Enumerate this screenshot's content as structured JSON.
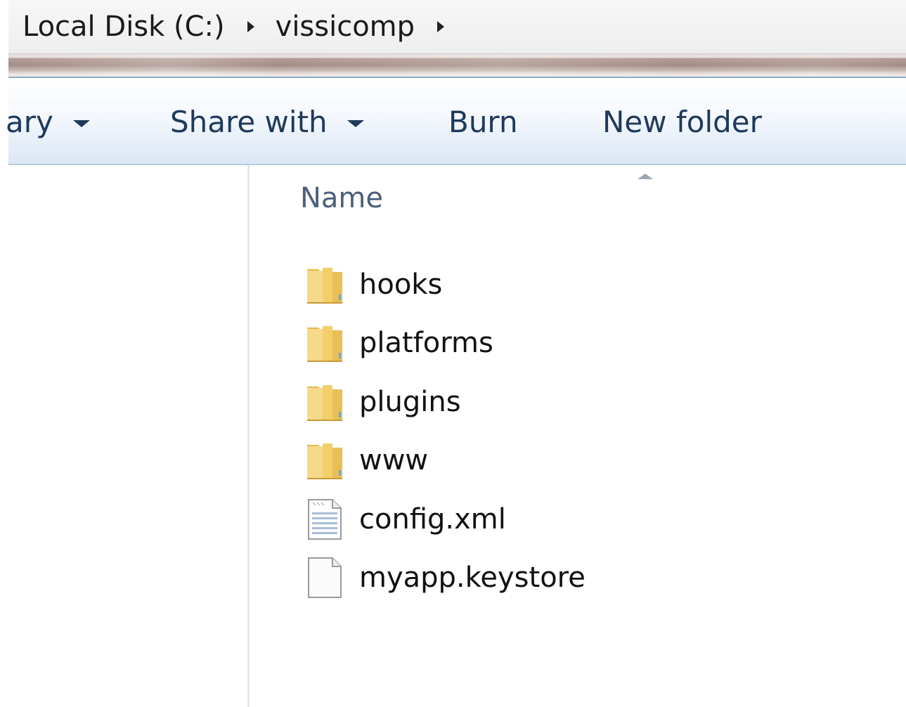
{
  "breadcrumb": {
    "items": [
      "Local Disk (C:)",
      "vissicomp"
    ]
  },
  "toolbar": {
    "library_label": "ary",
    "share_label": "Share with",
    "burn_label": "Burn",
    "new_folder_label": "New folder"
  },
  "filelist": {
    "column_name": "Name",
    "items": [
      {
        "name": "hooks",
        "icon": "folder-icon"
      },
      {
        "name": "platforms",
        "icon": "folder-icon"
      },
      {
        "name": "plugins",
        "icon": "folder-icon"
      },
      {
        "name": "www",
        "icon": "folder-icon"
      },
      {
        "name": "config.xml",
        "icon": "xml-document-icon"
      },
      {
        "name": "myapp.keystore",
        "icon": "generic-file-icon"
      }
    ]
  },
  "colors": {
    "toolbar_text": "#1e395b",
    "column_header_text": "#4c607a",
    "folder_yellow": "#f2cf6b",
    "address_separator_brown": "#a38d86"
  }
}
